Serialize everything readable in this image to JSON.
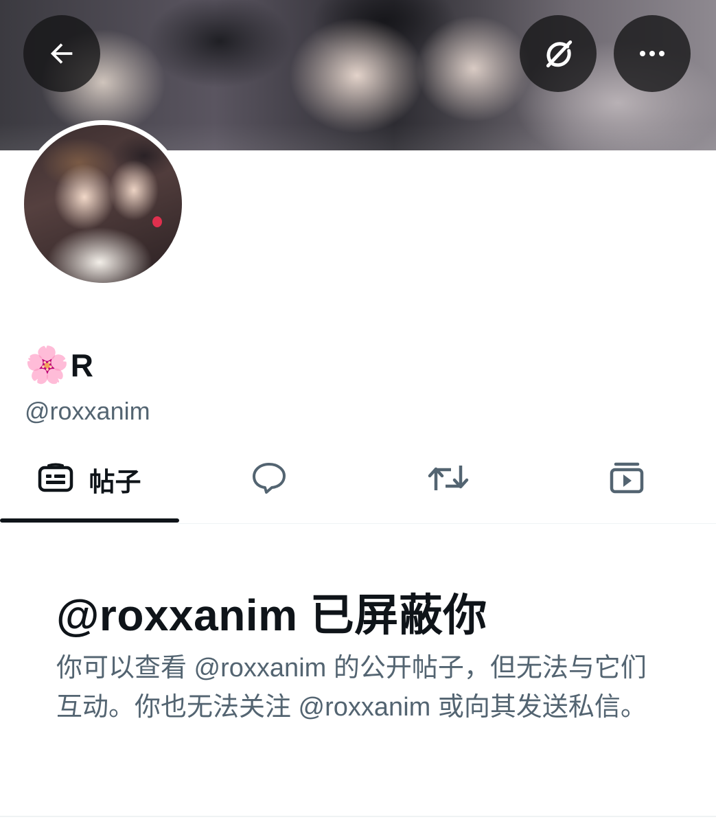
{
  "header": {
    "back_button": {
      "icon": "arrow-left-icon"
    },
    "grok_button": {
      "icon": "grok-icon"
    },
    "more_button": {
      "icon": "more-horizontal-icon"
    }
  },
  "profile": {
    "name_emoji": "🌸",
    "display_name": "R",
    "handle": "@roxxanim"
  },
  "tabs": [
    {
      "label": "帖子",
      "icon": "posts-icon",
      "selected": true
    },
    {
      "label": "",
      "icon": "reply-icon",
      "selected": false
    },
    {
      "label": "",
      "icon": "repost-icon",
      "selected": false
    },
    {
      "label": "",
      "icon": "media-icon",
      "selected": false
    }
  ],
  "blocked": {
    "title": "@roxxanim 已屏蔽你",
    "description": "你可以查看 @roxxanim 的公开帖子，但无法与它们互动。你也无法关注 @roxxanim 或向其发送私信。"
  },
  "colors": {
    "text_primary": "#0f1419",
    "text_secondary": "#536471",
    "divider": "#eff3f4",
    "overlay_button": "#141416"
  }
}
